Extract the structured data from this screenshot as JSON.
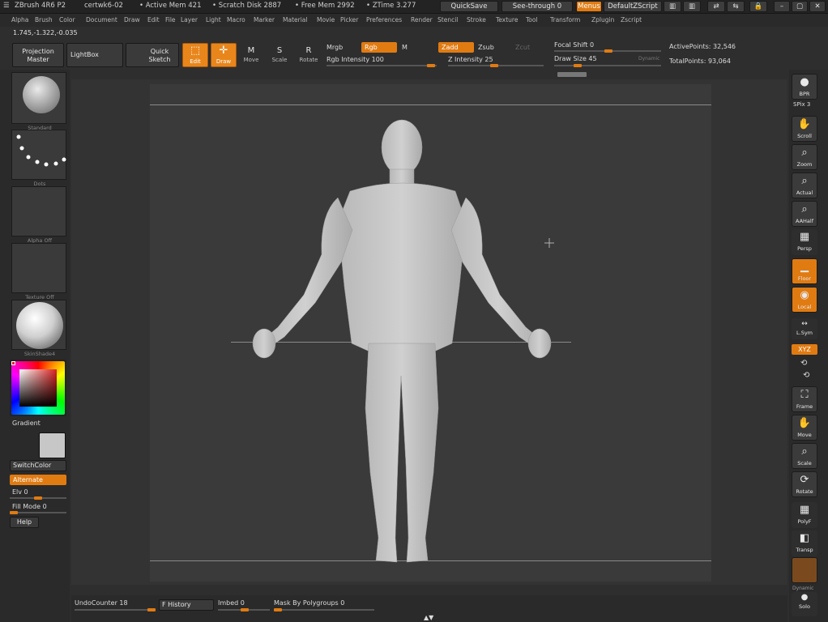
{
  "titlebar": {
    "app": "ZBrush 4R6 P2",
    "doc": "certwk6-02",
    "active_mem": "• Active Mem 421",
    "scratch": "• Scratch Disk 2887",
    "free_mem": "• Free Mem 2992",
    "ztime": "• ZTime 3.277",
    "quicksave": "QuickSave",
    "seethrough": "See-through  0",
    "menus": "Menus",
    "script": "DefaultZScript"
  },
  "menus": [
    "Alpha",
    "Brush",
    "Color",
    "Document",
    "Draw",
    "Edit",
    "File",
    "Layer",
    "Light",
    "Macro",
    "Marker",
    "Material",
    "Movie",
    "Picker",
    "Preferences",
    "Render",
    "Stencil",
    "Stroke",
    "Texture",
    "Tool",
    "Transform",
    "Zplugin",
    "Zscript"
  ],
  "coords": "1.745,-1.322,-0.035",
  "shelf": {
    "projection_master": "Projection Master",
    "lightbox": "LightBox",
    "quick_sketch": "Quick Sketch",
    "edit": "Edit",
    "draw": "Draw",
    "move": "Move",
    "scale": "Scale",
    "rotate": "Rotate",
    "mrgb": "Mrgb",
    "rgb": "Rgb",
    "m": "M",
    "rgb_intensity": "Rgb  Intensity 100",
    "zadd": "Zadd",
    "zsub": "Zsub",
    "zcut": "Zcut",
    "z_intensity": "Z  Intensity 25",
    "focal_shift": "Focal Shift 0",
    "draw_size": "Draw Size 45",
    "dynamic": "Dynamic",
    "active_points": "ActivePoints: 32,546",
    "total_points": "TotalPoints: 93,064"
  },
  "left": {
    "brush": "Standard",
    "stroke": "Dots",
    "alpha": "Alpha  Off",
    "texture": "Texture  Off",
    "material": "SkinShade4",
    "gradient": "Gradient",
    "switch_color": "SwitchColor",
    "alternate": "Alternate",
    "elv": "Elv 0",
    "fill_mode": "Fill Mode 0",
    "help": "Help"
  },
  "right": [
    "BPR",
    "SPix 3",
    "Scroll",
    "Zoom",
    "Actual",
    "AAHalf",
    "Persp",
    "Floor",
    "Local",
    "L.Sym",
    "XYZ",
    "Frame",
    "Move",
    "Scale",
    "Rotate",
    "PolyF",
    "Transp",
    "Dynamic",
    "Solo"
  ],
  "bottom": {
    "undo": "UndoCounter 18",
    "history": "F History",
    "imbed": "Imbed 0",
    "mask": "Mask By Polygroups 0"
  },
  "colors": {
    "accent": "#e07b12",
    "bg": "#2e2e2e",
    "canvas": "#3a3a3a"
  }
}
